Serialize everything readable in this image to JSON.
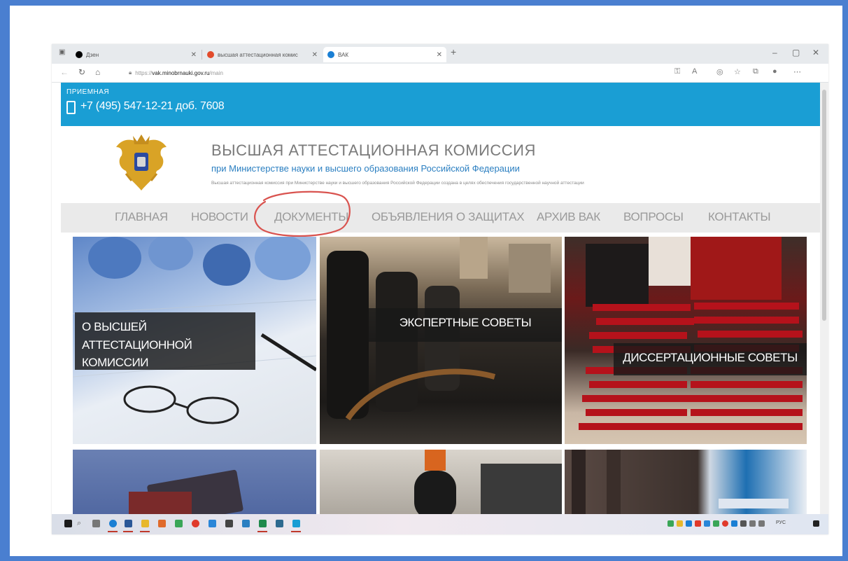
{
  "browser": {
    "tabs": [
      {
        "title": "Дзен",
        "favicon_color": "#000000",
        "active": false
      },
      {
        "title": "высшая аттестационная комис",
        "favicon_color": "#e24b2b",
        "active": false
      },
      {
        "title": "ВАК",
        "favicon_color": "#1a7fd4",
        "active": true
      }
    ],
    "new_tab_label": "+",
    "window_controls": {
      "minimize": "–",
      "maximize": "▢",
      "close": "✕"
    },
    "address": {
      "protocol": "https://",
      "host": "vak.minobrnauki.gov.ru",
      "path": "/main"
    }
  },
  "page": {
    "reception": {
      "label": "ПРИЕМНАЯ",
      "phone": "+7 (495) 547-12-21 доб. 7608"
    },
    "header": {
      "title": "ВЫСШАЯ АТТЕСТАЦИОННАЯ КОМИССИЯ",
      "subtitle": "при Министерстве науки и высшего образования Российской Федерации",
      "description": "Высшая аттестационная комиссия при Министерстве науки и высшего образования Российской Федерации создана в целях обеспечения государственной научной аттестации"
    },
    "nav": [
      "ГЛАВНАЯ",
      "НОВОСТИ",
      "ДОКУМЕНТЫ",
      "ОБЪЯВЛЕНИЯ О ЗАЩИТАХ",
      "АРХИВ ВАК",
      "ВОПРОСЫ",
      "КОНТАКТЫ"
    ],
    "annotation": {
      "target": "ДОКУМЕНТЫ",
      "color": "#d9534f"
    },
    "tiles": [
      {
        "caption_line1": "О ВЫСШЕЙ АТТЕСТАЦИОННОЙ",
        "caption_line2": "КОМИССИИ"
      },
      {
        "caption": "ЭКСПЕРТНЫЕ СОВЕТЫ"
      },
      {
        "caption": "ДИССЕРТАЦИОННЫЕ СОВЕТЫ"
      }
    ]
  },
  "taskbar": {
    "tray_text": "РУС",
    "accent": "#1a9ed4"
  },
  "colors": {
    "frame": "#4a7fd0",
    "header_band": "#1a9ed4",
    "link_blue": "#2b7fc1",
    "nav_bg": "#eaeaea"
  }
}
